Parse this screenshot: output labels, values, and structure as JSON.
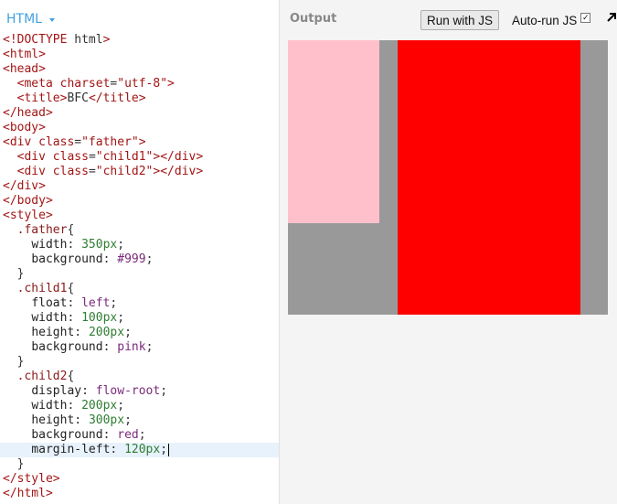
{
  "editor": {
    "mode_label": "HTML",
    "lines": [
      "<!DOCTYPE html>",
      "<html>",
      "<head>",
      "  <meta charset=\"utf-8\">",
      "  <title>BFC</title>",
      "</head>",
      "<body>",
      "<div class=\"father\">",
      "  <div class=\"child1\"></div>",
      "  <div class=\"child2\"></div>",
      "</div>",
      "</body>",
      "<style>",
      "  .father{",
      "    width: 350px;",
      "    background: #999;",
      "  }",
      "  .child1{",
      "    float: left;",
      "    width: 100px;",
      "    height: 200px;",
      "    background: pink;",
      "  }",
      "  .child2{",
      "    display: flow-root;",
      "    width: 200px;",
      "    height: 300px;",
      "    background: red;",
      "    margin-left: 120px;",
      "  }",
      "</style>",
      "</html>"
    ],
    "active_line": 28
  },
  "output": {
    "label": "Output",
    "run_button_label": "Run with JS",
    "autorun_label": "Auto-run JS",
    "autorun_checked": true
  },
  "preview": {
    "father_color": "#999999",
    "child1_color": "#ffc0cb",
    "child2_color": "#ff0000"
  }
}
